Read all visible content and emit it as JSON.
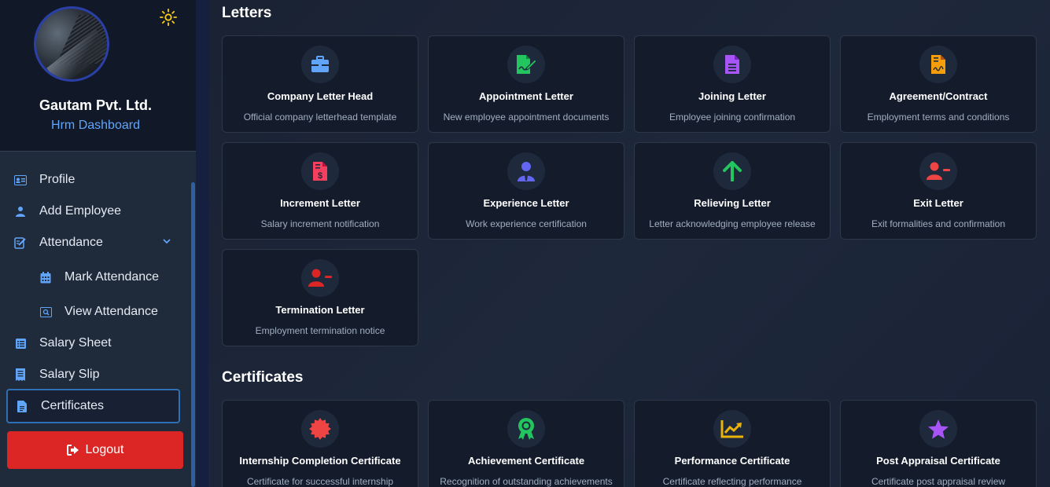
{
  "sidebar": {
    "company_name": "Gautam Pvt. Ltd.",
    "subtitle": "Hrm Dashboard",
    "items": [
      {
        "label": "Profile",
        "icon": "id-card-icon"
      },
      {
        "label": "Add Employee",
        "icon": "user-icon"
      },
      {
        "label": "Attendance",
        "icon": "attendance-icon",
        "expanded": true
      },
      {
        "label": "Mark Attendance",
        "icon": "calendar-icon"
      },
      {
        "label": "View Attendance",
        "icon": "view-search-icon"
      },
      {
        "label": "Salary Sheet",
        "icon": "list-icon"
      },
      {
        "label": "Salary Slip",
        "icon": "receipt-icon"
      },
      {
        "label": "Certificates",
        "icon": "document-icon",
        "active": true
      }
    ],
    "logout_label": "Logout"
  },
  "sections": {
    "letters_title": "Letters",
    "certificates_title": "Certificates"
  },
  "letters": [
    {
      "title": "Company Letter Head",
      "desc": "Official company letterhead template",
      "icon": "briefcase-icon",
      "color": "#60a5fa"
    },
    {
      "title": "Appointment Letter",
      "desc": "New employee appointment documents",
      "icon": "signature-icon",
      "color": "#22c55e"
    },
    {
      "title": "Joining Letter",
      "desc": "Employee joining confirmation",
      "icon": "file-text-icon",
      "color": "#a855f7"
    },
    {
      "title": "Agreement/Contract",
      "desc": "Employment terms and conditions",
      "icon": "contract-icon",
      "color": "#f59e0b"
    },
    {
      "title": "Increment Letter",
      "desc": "Salary increment notification",
      "icon": "file-dollar-icon",
      "color": "#f43f5e"
    },
    {
      "title": "Experience Letter",
      "desc": "Work experience certification",
      "icon": "user-tie-icon",
      "color": "#6366f1"
    },
    {
      "title": "Relieving Letter",
      "desc": "Letter acknowledging employee release",
      "icon": "arrow-up-icon",
      "color": "#22c55e"
    },
    {
      "title": "Exit Letter",
      "desc": "Exit formalities and confirmation",
      "icon": "user-minus-icon",
      "color": "#ef4444"
    },
    {
      "title": "Termination Letter",
      "desc": "Employment termination notice",
      "icon": "user-minus-icon",
      "color": "#dc2626"
    }
  ],
  "certificates": [
    {
      "title": "Internship Completion Certificate",
      "desc": "Certificate for successful internship",
      "icon": "certificate-icon",
      "color": "#ef4444"
    },
    {
      "title": "Achievement Certificate",
      "desc": "Recognition of outstanding achievements",
      "icon": "award-icon",
      "color": "#22c55e"
    },
    {
      "title": "Performance Certificate",
      "desc": "Certificate reflecting performance",
      "icon": "chart-line-icon",
      "color": "#eab308"
    },
    {
      "title": "Post Appraisal Certificate",
      "desc": "Certificate post appraisal review",
      "icon": "star-icon",
      "color": "#a855f7"
    }
  ]
}
